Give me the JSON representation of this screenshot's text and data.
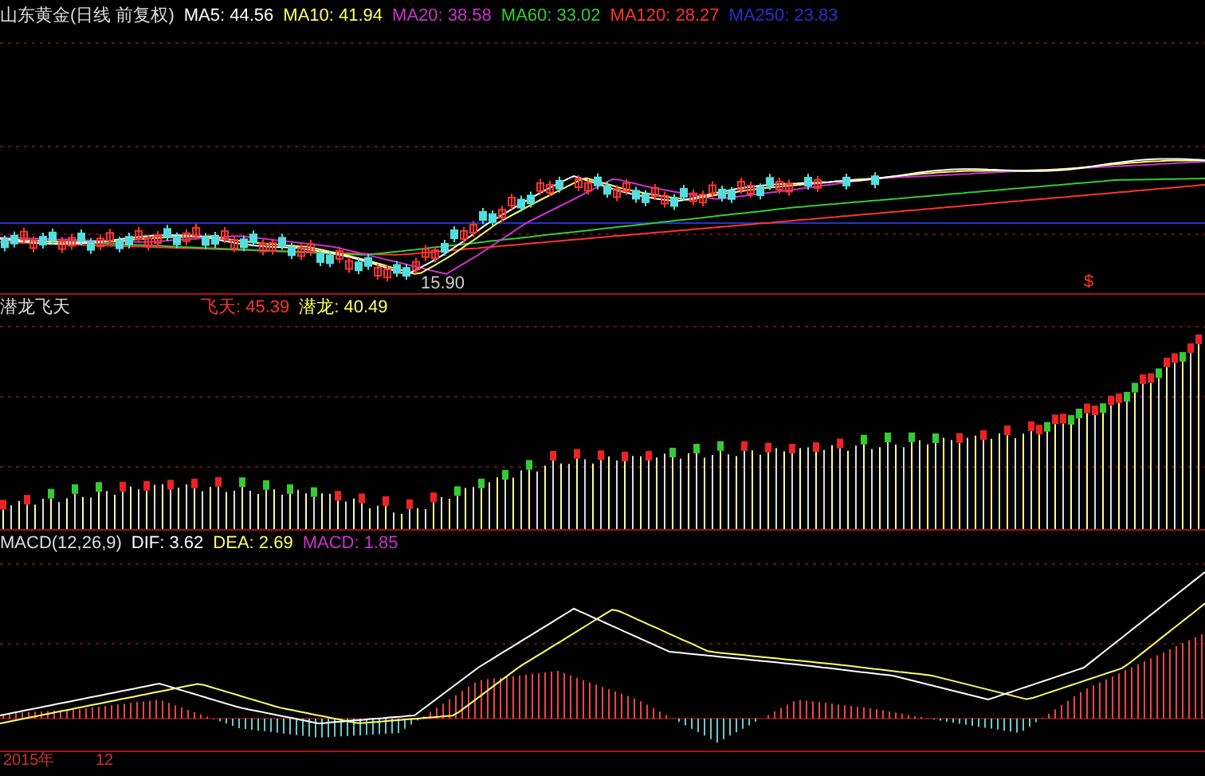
{
  "main_panel": {
    "title": "山东黄金(日线 前复权)",
    "indicators": [
      {
        "label": "MA5: 44.56",
        "color": "#ffffff"
      },
      {
        "label": "MA10: 41.94",
        "color": "#ffff66"
      },
      {
        "label": "MA20: 38.58",
        "color": "#cc33cc"
      },
      {
        "label": "MA60: 33.02",
        "color": "#33cc33"
      },
      {
        "label": "MA120: 28.27",
        "color": "#ff3333"
      },
      {
        "label": "MA250: 23.83",
        "color": "#2233cc"
      }
    ],
    "low_price_label": "15.90",
    "signal_marker": "$"
  },
  "indicator_panel": {
    "title": "潜龙飞天",
    "indicators": [
      {
        "label": "飞天: 45.39",
        "color": "#ff3333"
      },
      {
        "label": "潜龙: 40.49",
        "color": "#ffff66"
      }
    ]
  },
  "macd_panel": {
    "title": "MACD(12,26,9)",
    "indicators": [
      {
        "label": "DIF: 3.62",
        "color": "#ffffff"
      },
      {
        "label": "DEA: 2.69",
        "color": "#ffff66"
      },
      {
        "label": "MACD: 1.85",
        "color": "#cc33cc"
      }
    ]
  },
  "time_axis": {
    "labels": [
      "2015年",
      "12"
    ]
  }
}
